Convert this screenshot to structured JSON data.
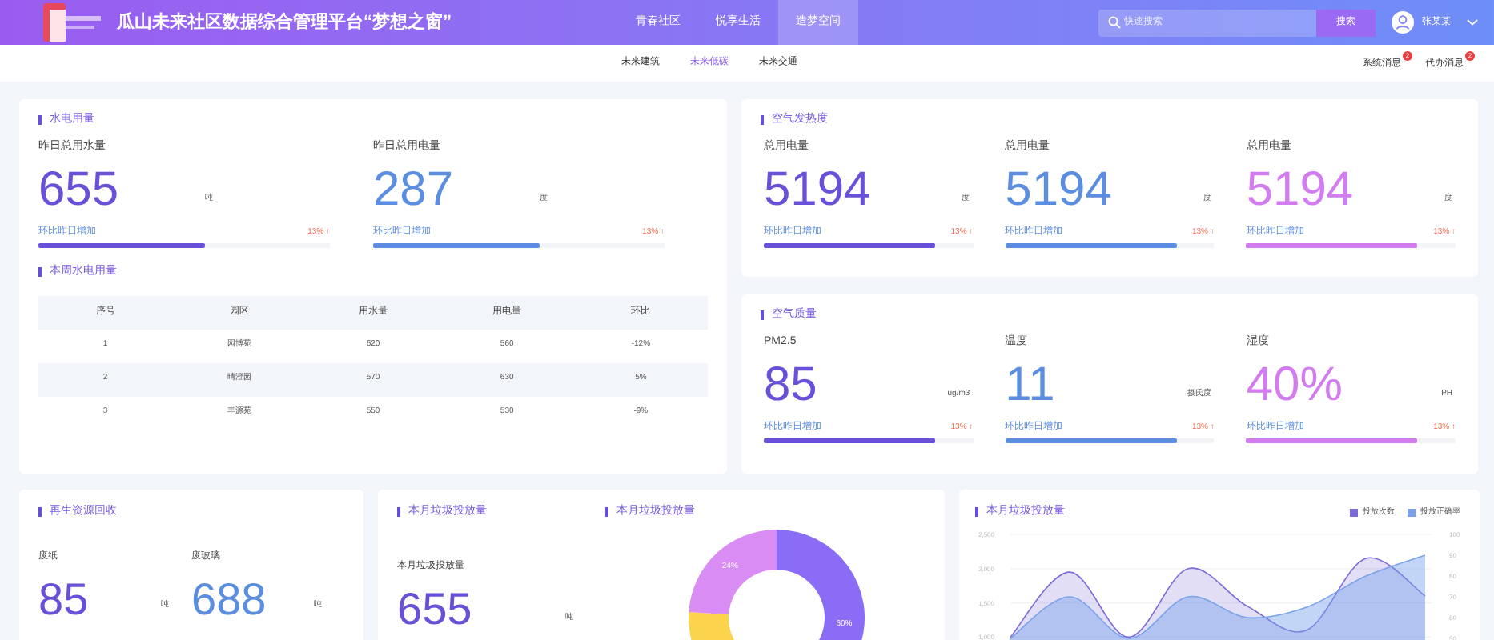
{
  "header": {
    "title": "瓜山未来社区数据综合管理平台“梦想之窗”",
    "nav": [
      {
        "label": "青春社区",
        "selected": false
      },
      {
        "label": "悦享生活",
        "selected": false
      },
      {
        "label": "造梦空间",
        "selected": true
      }
    ],
    "search": {
      "placeholder": "快速搜索"
    },
    "search_button": "搜索",
    "user": "张某某"
  },
  "subnav": {
    "tabs": [
      {
        "label": "未来建筑",
        "selected": false
      },
      {
        "label": "未来低碳",
        "selected": true
      },
      {
        "label": "未来交通",
        "selected": false
      }
    ],
    "messages": [
      {
        "label": "系统消息",
        "badge": "2"
      },
      {
        "label": "代办消息",
        "badge": "2"
      }
    ]
  },
  "water_power": {
    "title": "水电用量",
    "metrics": [
      {
        "label": "昨日总用水量",
        "value": "655",
        "unit": "吨",
        "trend_label": "环比昨日增加",
        "trend": "13% ↑",
        "level": 0.57,
        "color": "#6a4fd8"
      },
      {
        "label": "昨日总用电量",
        "value": "287",
        "unit": "度",
        "trend_label": "环比昨日增加",
        "trend": "13% ↑",
        "level": 0.57,
        "color": "#5b8ee0"
      }
    ]
  },
  "weekly": {
    "title": "本周水电用量",
    "columns": [
      "序号",
      "园区",
      "用水量",
      "用电量",
      "环比"
    ],
    "rows": [
      [
        "1",
        "园博苑",
        "620",
        "560",
        "-12%"
      ],
      [
        "2",
        "晴澄园",
        "570",
        "630",
        "5%"
      ],
      [
        "3",
        "丰源苑",
        "550",
        "530",
        "-9%"
      ]
    ]
  },
  "air_heat": {
    "title": "空气发热度",
    "metrics": [
      {
        "label": "总用电量",
        "value": "5194",
        "unit": "度",
        "trend_label": "环比昨日增加",
        "trend": "13% ↑",
        "level": 0.82,
        "color": "#6a4fd8"
      },
      {
        "label": "总用电量",
        "value": "5194",
        "unit": "度",
        "trend_label": "环比昨日增加",
        "trend": "13% ↑",
        "level": 0.82,
        "color": "#5b8ee0"
      },
      {
        "label": "总用电量",
        "value": "5194",
        "unit": "度",
        "trend_label": "环比昨日增加",
        "trend": "13% ↑",
        "level": 0.82,
        "color": "#d27cf0"
      }
    ]
  },
  "air_quality": {
    "title": "空气质量",
    "metrics": [
      {
        "label": "PM2.5",
        "value": "85",
        "unit": "ug/m3",
        "trend_label": "环比昨日增加",
        "trend": "13% ↑",
        "level": 0.82,
        "color": "#6a4fd8"
      },
      {
        "label": "温度",
        "value": "11",
        "unit": "摄氏度",
        "trend_label": "环比昨日增加",
        "trend": "13% ↑",
        "level": 0.82,
        "color": "#5b8ee0"
      },
      {
        "label": "湿度",
        "value": "40%",
        "unit": "PH",
        "trend_label": "环比昨日增加",
        "trend": "13% ↑",
        "level": 0.82,
        "color": "#d27cf0"
      }
    ]
  },
  "recycling": {
    "title": "再生资源回收",
    "metrics": [
      {
        "label": "废纸",
        "value": "85",
        "unit": "吨",
        "color": "#6a4fd8"
      },
      {
        "label": "废玻璃",
        "value": "688",
        "unit": "吨",
        "color": "#5b8ee0"
      }
    ]
  },
  "garbage": {
    "title": "本月垃圾投放量",
    "label": "本月垃圾投放量",
    "value": "655",
    "unit": "吨"
  },
  "donut": {
    "title": "本月垃圾投放量",
    "chart_data": {
      "type": "donut",
      "values": [
        60,
        16,
        24
      ],
      "colors": [
        "#8b6cf6",
        "#fcd34d",
        "#d98cf3"
      ],
      "value_labels": [
        "60%",
        null,
        "24%"
      ]
    }
  },
  "trend": {
    "title": "本月垃圾投放量",
    "chart_data": {
      "type": "area",
      "series": [
        {
          "name": "投放次数",
          "color": "#7c6ad8",
          "values": [
            1000,
            1950,
            1000,
            2000,
            1450,
            1100,
            2150,
            1600
          ]
        },
        {
          "name": "投放正确率",
          "color": "#7aa2ea",
          "axis": "y2",
          "values": [
            50,
            70,
            50,
            70,
            60,
            65,
            80,
            90
          ]
        }
      ],
      "grid": true,
      "ylim": [
        1000,
        2500
      ],
      "yticks": [
        {
          "value": 2500,
          "label": "2,500"
        },
        {
          "value": 2000,
          "label": "2,000"
        },
        {
          "value": 1500,
          "label": "1,500"
        },
        {
          "value": 1000,
          "label": "1,000"
        }
      ],
      "y2lim": [
        50,
        100
      ],
      "y2ticks": [
        100,
        90,
        80,
        70,
        60,
        50
      ]
    }
  }
}
